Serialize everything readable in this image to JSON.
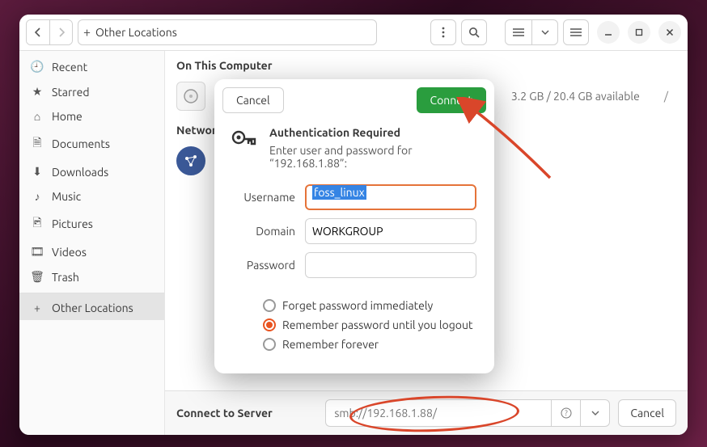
{
  "titlebar": {
    "path_label": "Other Locations"
  },
  "sidebar": {
    "items": [
      {
        "label": "Recent"
      },
      {
        "label": "Starred"
      },
      {
        "label": "Home"
      },
      {
        "label": "Documents"
      },
      {
        "label": "Downloads"
      },
      {
        "label": "Music"
      },
      {
        "label": "Pictures"
      },
      {
        "label": "Videos"
      },
      {
        "label": "Trash"
      },
      {
        "label": "Other Locations"
      }
    ]
  },
  "content": {
    "section_computer": "On This Computer",
    "drive_size": "3.2 GB / 20.4 GB available",
    "drive_path": "/",
    "section_networks": "Networks"
  },
  "connect": {
    "label": "Connect to Server",
    "placeholder": "smb://192.168.1.88/",
    "help": "?",
    "cancel": "Cancel"
  },
  "dialog": {
    "cancel": "Cancel",
    "connect": "Connect",
    "title": "Authentication Required",
    "message": "Enter user and password for “192.168.1.88”:",
    "username_label": "Username",
    "username_value": "foss_linux",
    "domain_label": "Domain",
    "domain_value": "WORKGROUP",
    "password_label": "Password",
    "password_value": "",
    "radio_forget": "Forget password immediately",
    "radio_session": "Remember password until you logout",
    "radio_forever": "Remember forever"
  }
}
